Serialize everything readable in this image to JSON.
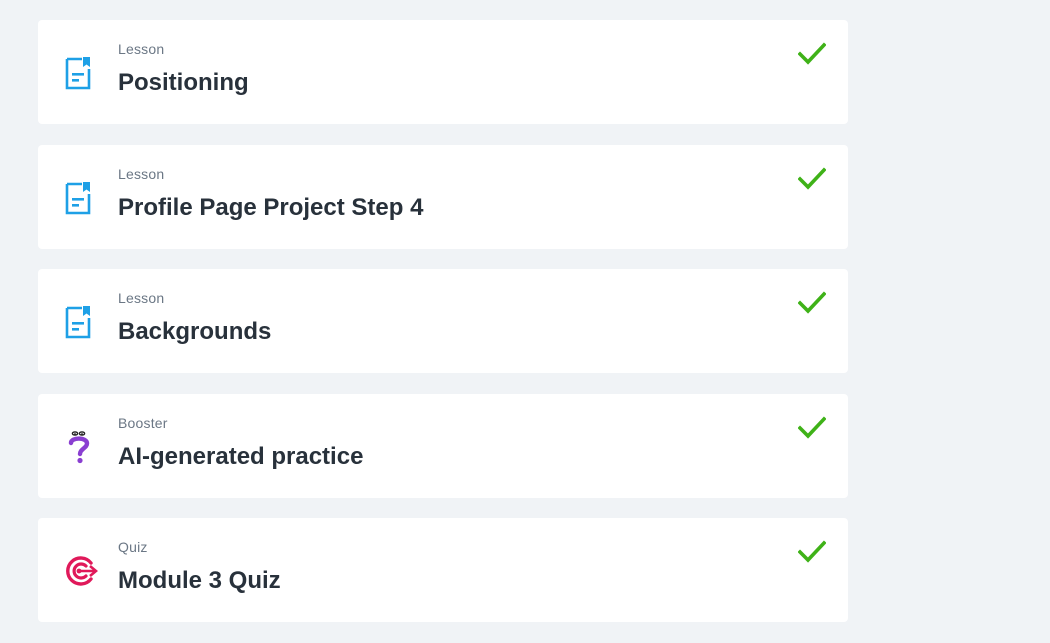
{
  "colors": {
    "page_background": "#f0f3f6",
    "card_background": "#ffffff",
    "lesson_icon": "#1ea0e6",
    "booster_icon": "#8a3fd1",
    "quiz_icon": "#e0195a",
    "check": "#3fb218",
    "kind_text": "#6b7785",
    "title_text": "#28313b"
  },
  "items": [
    {
      "kind": "Lesson",
      "title": "Positioning",
      "icon": "lesson-document-icon",
      "status": "completed"
    },
    {
      "kind": "Lesson",
      "title": "Profile Page Project Step 4",
      "icon": "lesson-document-icon",
      "status": "completed"
    },
    {
      "kind": "Lesson",
      "title": "Backgrounds",
      "icon": "lesson-document-icon",
      "status": "completed"
    },
    {
      "kind": "Booster",
      "title": "AI-generated practice",
      "icon": "booster-question-icon",
      "status": "completed"
    },
    {
      "kind": "Quiz",
      "title": "Module 3 Quiz",
      "icon": "quiz-target-icon",
      "status": "completed"
    }
  ]
}
